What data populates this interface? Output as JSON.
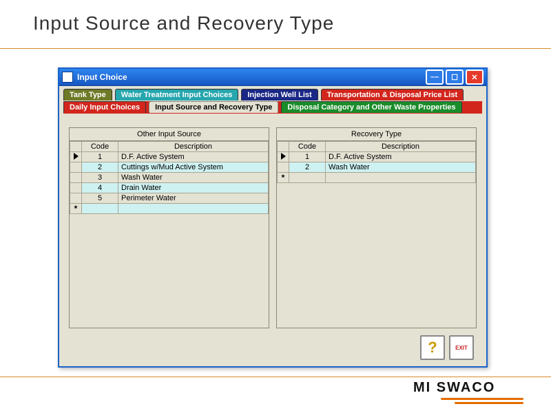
{
  "slide": {
    "title": "Input Source and Recovery Type",
    "logo": "MI SWACO"
  },
  "window": {
    "title": "Input Choice",
    "min_tip": "Minimize",
    "max_tip": "Maximize",
    "close_tip": "Close"
  },
  "tabs": {
    "row1": [
      {
        "label": "Tank Type",
        "style": "t-olive"
      },
      {
        "label": "Water Treatment Input Choices",
        "style": "t-teal"
      },
      {
        "label": "Injection Well List",
        "style": "t-navy"
      },
      {
        "label": "Transportation & Disposal Price List",
        "style": "t-red"
      }
    ],
    "row2": [
      {
        "label": "Daily Input Choices",
        "style": "t-red"
      },
      {
        "label": "Input Source and Recovery Type",
        "style": "active"
      },
      {
        "label": "Disposal Category and Other Waste Properties",
        "style": "t-green"
      }
    ]
  },
  "left_panel": {
    "title": "Other Input Source",
    "col_code": "Code",
    "col_desc": "Description",
    "rows": [
      {
        "code": "1",
        "desc": "D.F. Active System"
      },
      {
        "code": "2",
        "desc": "Cuttings w/Mud Active System"
      },
      {
        "code": "3",
        "desc": "Wash Water"
      },
      {
        "code": "4",
        "desc": "Drain Water"
      },
      {
        "code": "5",
        "desc": "Perimeter Water"
      }
    ]
  },
  "right_panel": {
    "title": "Recovery Type",
    "col_code": "Code",
    "col_desc": "Description",
    "rows": [
      {
        "code": "1",
        "desc": "D.F. Active System"
      },
      {
        "code": "2",
        "desc": "Wash Water"
      }
    ]
  },
  "footer": {
    "help": "?",
    "exit": "EXIT"
  }
}
